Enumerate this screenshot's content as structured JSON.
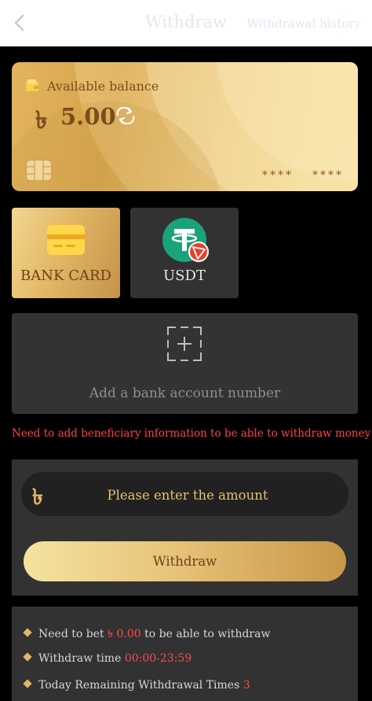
{
  "header": {
    "title": "Withdraw",
    "history_link": "Withdrawal history"
  },
  "balance_card": {
    "label": "Available balance",
    "currency_symbol": "৳",
    "amount": "5.00",
    "mask_1": "****",
    "mask_2": "****"
  },
  "methods": [
    {
      "label": "BANK CARD",
      "icon": "bank-card-icon",
      "selected": true
    },
    {
      "label": "USDT",
      "icon": "usdt-tron-icon",
      "selected": false
    }
  ],
  "add_account": {
    "label": "Add a bank account number"
  },
  "warning": "Need to add beneficiary information to be able to withdraw money",
  "amount_form": {
    "currency_symbol": "৳",
    "placeholder": "Please enter the amount",
    "button_label": "Withdraw"
  },
  "rules": {
    "bet": {
      "before": "Need to bet ",
      "value": "৳ 0.00",
      "after": " to be able to withdraw"
    },
    "time": {
      "before": "Withdraw time ",
      "value": "00:00-23:59"
    },
    "remaining": {
      "before": "Today Remaining Withdrawal Times ",
      "value": "3"
    }
  },
  "colors": {
    "accent_gold": "#e2b766",
    "warning_red": "#ff4343",
    "panel_bg": "#323232"
  }
}
